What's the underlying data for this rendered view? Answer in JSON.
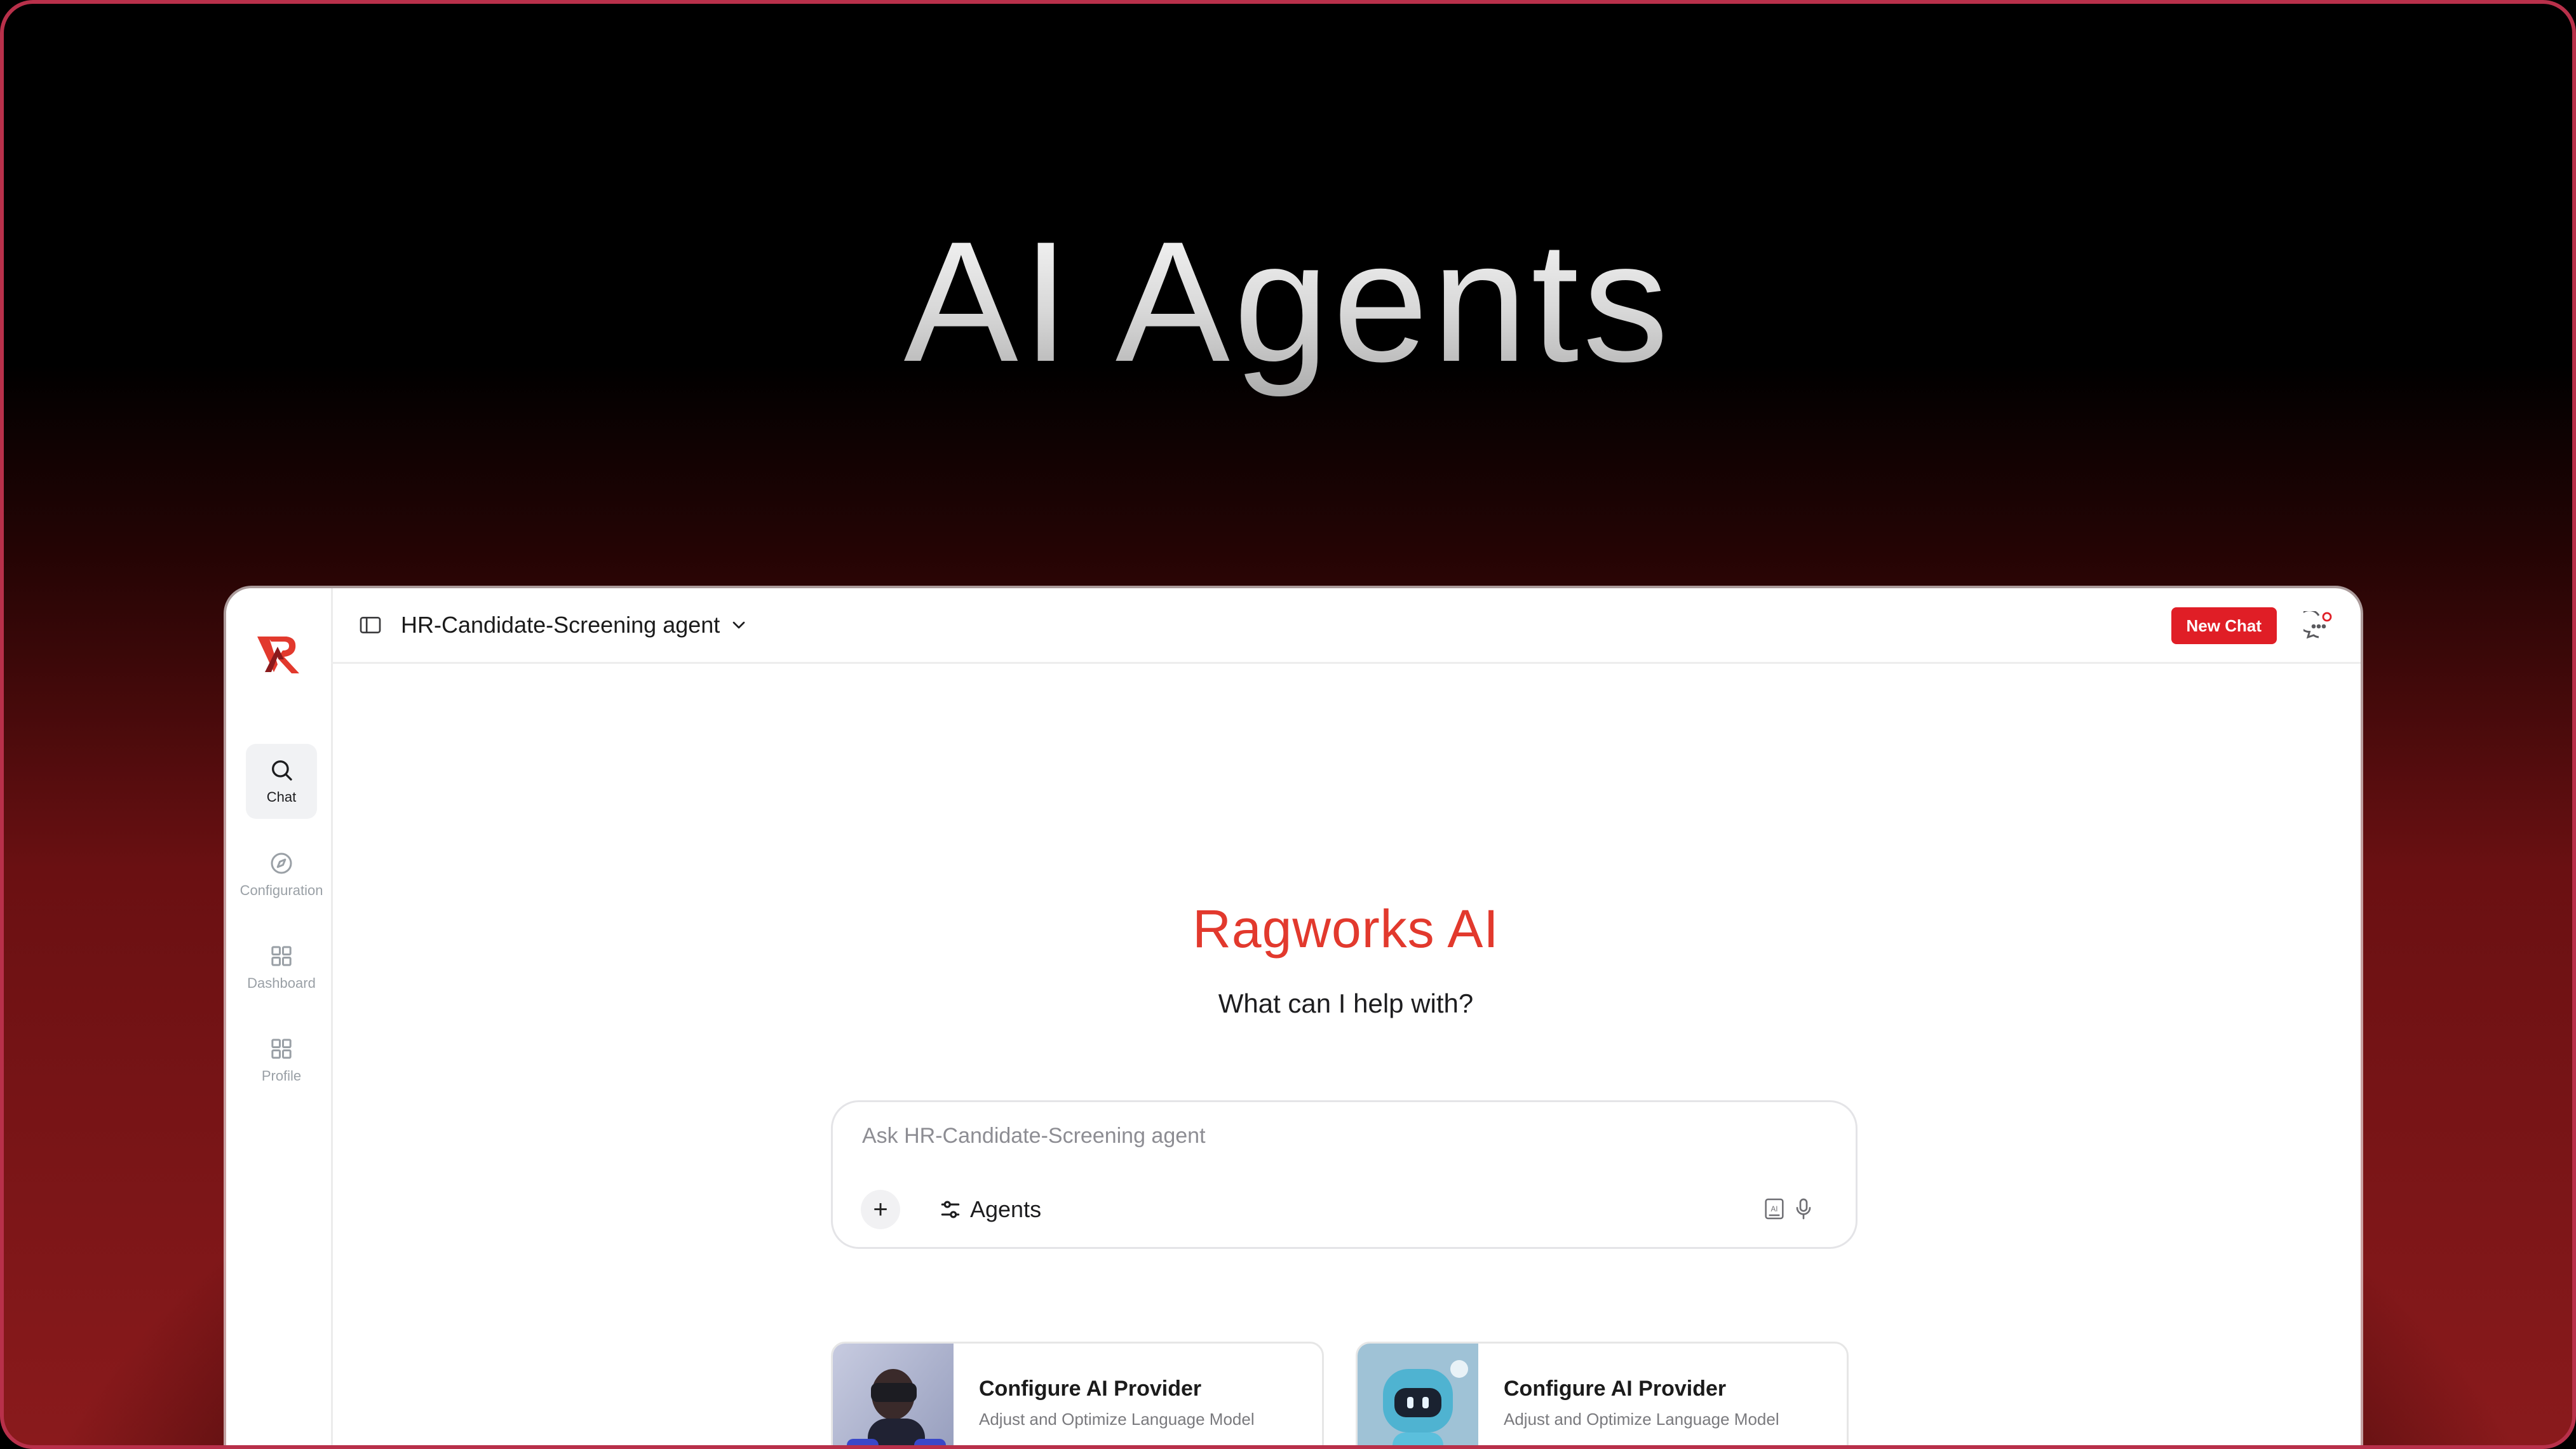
{
  "hero": {
    "title": "AI Agents"
  },
  "sidebar": {
    "items": [
      {
        "label": "Chat",
        "icon": "search-icon",
        "active": true
      },
      {
        "label": "Configuration",
        "icon": "compass-icon",
        "active": false
      },
      {
        "label": "Dashboard",
        "icon": "grid-icon",
        "active": false
      },
      {
        "label": "Profile",
        "icon": "grid-icon",
        "active": false
      }
    ]
  },
  "header": {
    "agent_name": "HR-Candidate-Screening agent",
    "new_chat_label": "New Chat"
  },
  "main": {
    "brand": "Ragworks AI",
    "subtitle": "What can I help with?",
    "input_placeholder": "Ask HR-Candidate-Screening agent",
    "agents_label": "Agents",
    "plus_label": "+"
  },
  "cards": [
    {
      "title": "Configure AI Provider",
      "description": "Adjust and Optimize Language Model"
    },
    {
      "title": "Configure AI Provider",
      "description": "Adjust and Optimize Language Model"
    }
  ],
  "colors": {
    "accent": "#e01e26",
    "brand": "#e2392d",
    "background_glow": "#a81c20"
  }
}
